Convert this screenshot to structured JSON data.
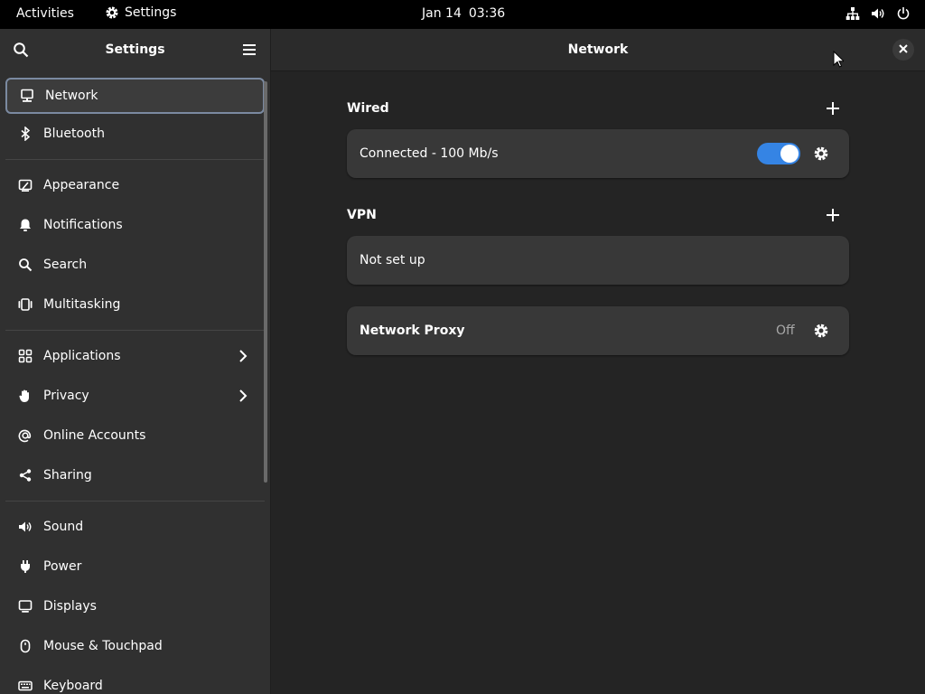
{
  "topbar": {
    "activities": "Activities",
    "app_name": "Settings",
    "date": "Jan 14",
    "time": "03:36",
    "status_icons": [
      "network-wired-icon",
      "volume-icon",
      "power-icon"
    ]
  },
  "sidebar": {
    "title": "Settings",
    "groups": [
      [
        {
          "label": "Network",
          "icon": "network-icon",
          "selected": true
        },
        {
          "label": "Bluetooth",
          "icon": "bluetooth-icon"
        }
      ],
      [
        {
          "label": "Appearance",
          "icon": "appearance-icon"
        },
        {
          "label": "Notifications",
          "icon": "bell-icon"
        },
        {
          "label": "Search",
          "icon": "search-icon"
        },
        {
          "label": "Multitasking",
          "icon": "multitasking-icon"
        }
      ],
      [
        {
          "label": "Applications",
          "icon": "applications-icon",
          "submenu": true
        },
        {
          "label": "Privacy",
          "icon": "hand-icon",
          "submenu": true
        },
        {
          "label": "Online Accounts",
          "icon": "at-icon"
        },
        {
          "label": "Sharing",
          "icon": "share-icon"
        }
      ],
      [
        {
          "label": "Sound",
          "icon": "sound-icon"
        },
        {
          "label": "Power",
          "icon": "power-plug-icon"
        },
        {
          "label": "Displays",
          "icon": "display-icon"
        },
        {
          "label": "Mouse & Touchpad",
          "icon": "mouse-icon"
        },
        {
          "label": "Keyboard",
          "icon": "keyboard-icon"
        }
      ]
    ]
  },
  "content": {
    "title": "Network",
    "wired": {
      "section_title": "Wired",
      "status": "Connected - 100 Mb/s",
      "enabled": true
    },
    "vpn": {
      "section_title": "VPN",
      "status": "Not set up"
    },
    "proxy": {
      "label": "Network Proxy",
      "state": "Off"
    }
  },
  "colors": {
    "accent": "#3584e4",
    "window_bg": "#242424",
    "sidebar_bg": "#303030",
    "card_bg": "#383838",
    "topbar_bg": "#000000"
  }
}
